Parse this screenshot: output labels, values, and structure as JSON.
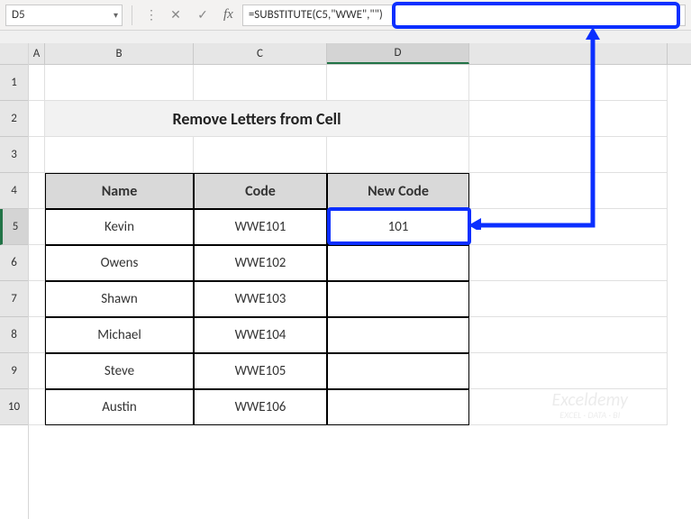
{
  "nameBox": "D5",
  "formula": "=SUBSTITUTE(C5,\"WWE\",\"\")",
  "columns": [
    "A",
    "B",
    "C",
    "D"
  ],
  "rowNums": [
    "1",
    "2",
    "3",
    "4",
    "5",
    "6",
    "7",
    "8",
    "9",
    "10"
  ],
  "title": "Remove Letters from Cell",
  "headers": {
    "name": "Name",
    "code": "Code",
    "newcode": "New Code"
  },
  "data": [
    {
      "name": "Kevin",
      "code": "WWE101",
      "newcode": "101"
    },
    {
      "name": "Owens",
      "code": "WWE102",
      "newcode": ""
    },
    {
      "name": "Shawn",
      "code": "WWE103",
      "newcode": ""
    },
    {
      "name": "Michael",
      "code": "WWE104",
      "newcode": ""
    },
    {
      "name": "Steve",
      "code": "WWE105",
      "newcode": ""
    },
    {
      "name": "Austin",
      "code": "WWE106",
      "newcode": ""
    }
  ],
  "watermark": {
    "main": "Exceldemy",
    "sub": "EXCEL · DATA · BI"
  },
  "colors": {
    "annotation": "#0b2fff",
    "excelGreen": "#217346"
  }
}
